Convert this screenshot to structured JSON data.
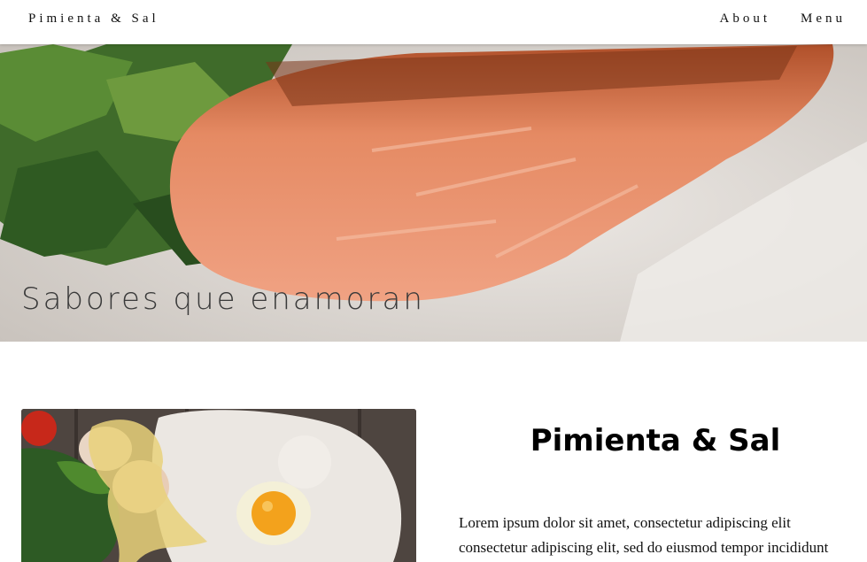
{
  "header": {
    "brand": "Pimienta & Sal",
    "nav": [
      {
        "label": "About"
      },
      {
        "label": "Menu"
      }
    ]
  },
  "hero": {
    "caption": "Sabores que enamoran",
    "image": "grilled-salmon-with-salad-photo"
  },
  "section": {
    "image": "baking-ingredients-flour-egg-photo",
    "title": "Pimienta & Sal",
    "paragraph_line1": "Lorem ipsum dolor sit amet, consectetur adipiscing elit",
    "paragraph_line2": "consectetur adipiscing elit, sed do eiusmod tempor incididunt"
  }
}
